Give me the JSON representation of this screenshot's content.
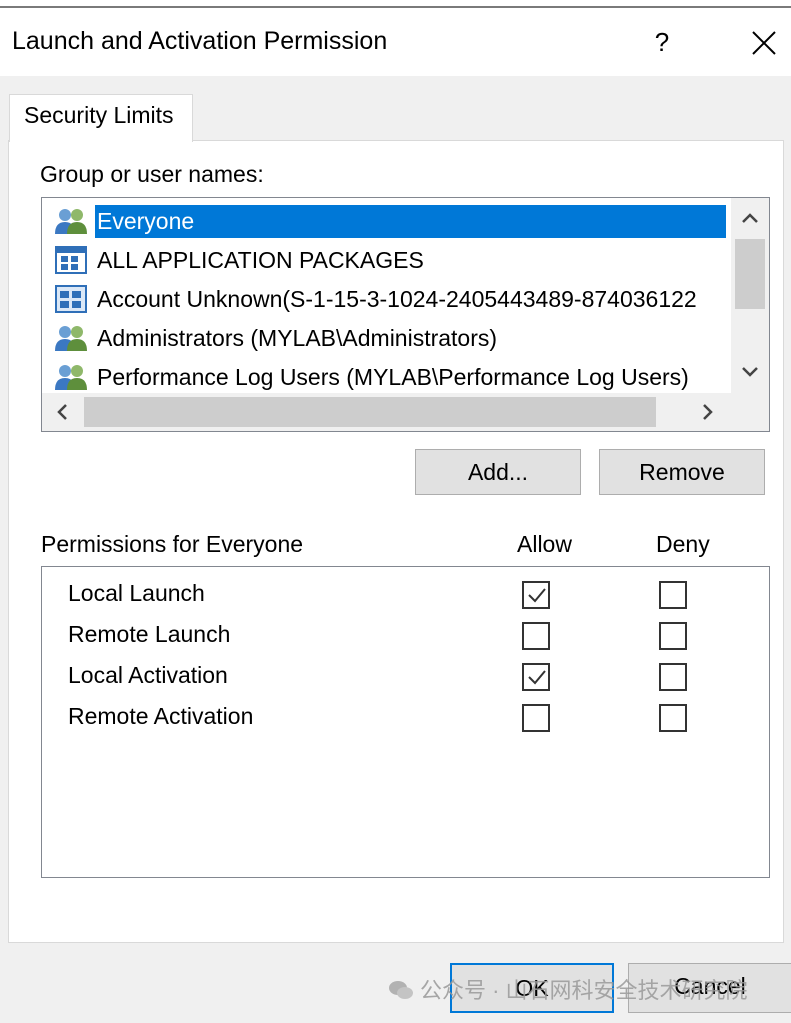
{
  "dialog": {
    "title": "Launch and Activation Permission",
    "help": "?"
  },
  "tab": {
    "label": "Security Limits"
  },
  "groups": {
    "label": "Group or user names:",
    "items": [
      {
        "label": "Everyone",
        "icon": "group-users-icon",
        "selected": true
      },
      {
        "label": "ALL APPLICATION PACKAGES",
        "icon": "app-packages-icon",
        "selected": false
      },
      {
        "label": "Account Unknown(S-1-15-3-1024-2405443489-874036122",
        "icon": "unknown-account-icon",
        "selected": false
      },
      {
        "label": "Administrators (MYLAB\\Administrators)",
        "icon": "group-users-icon",
        "selected": false
      },
      {
        "label": "Performance Log Users (MYLAB\\Performance Log Users)",
        "icon": "group-users-icon",
        "selected": false
      }
    ]
  },
  "buttons": {
    "add": "Add...",
    "remove": "Remove",
    "ok": "OK",
    "cancel": "Cancel"
  },
  "permissions": {
    "label": "Permissions for Everyone",
    "allow_header": "Allow",
    "deny_header": "Deny",
    "rows": [
      {
        "name": "Local Launch",
        "allow": true,
        "deny": false
      },
      {
        "name": "Remote Launch",
        "allow": false,
        "deny": false
      },
      {
        "name": "Local Activation",
        "allow": true,
        "deny": false
      },
      {
        "name": "Remote Activation",
        "allow": false,
        "deny": false
      }
    ]
  },
  "watermark": "公众号 · 山石网科安全技术研究院",
  "colors": {
    "selection": "#0078d7",
    "focus_border": "#0078d7"
  }
}
